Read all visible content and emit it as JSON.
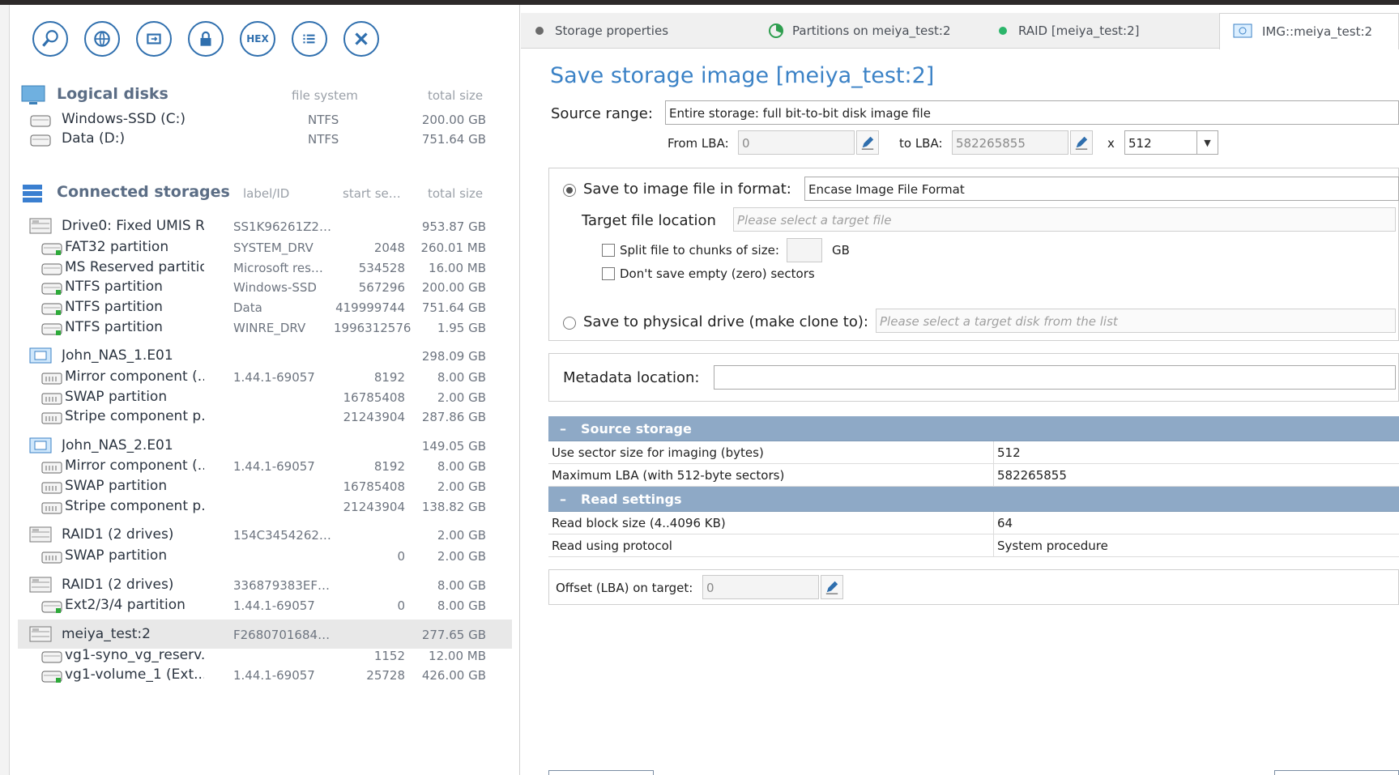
{
  "toolbar": {
    "buttons": [
      {
        "icon": "search-icon"
      },
      {
        "icon": "globe-icon"
      },
      {
        "icon": "sync-icon"
      },
      {
        "icon": "lock-icon"
      },
      {
        "icon": "hex-icon",
        "label": "HEX"
      },
      {
        "icon": "list-icon"
      },
      {
        "icon": "close-icon"
      }
    ]
  },
  "logical": {
    "title": "Logical disks",
    "col_fs": "file system",
    "col_size": "total size",
    "items": [
      {
        "name": "Windows-SSD (C:)",
        "fs": "NTFS",
        "size": "200.00 GB"
      },
      {
        "name": "Data (D:)",
        "fs": "NTFS",
        "size": "751.64 GB"
      }
    ]
  },
  "storages": {
    "title": "Connected storages",
    "col_label": "label/ID",
    "col_start": "start se…",
    "col_size": "total size",
    "items": [
      {
        "name": "Drive0: Fixed UMIS R...",
        "label": "SS1K96261Z2…",
        "start": "",
        "size": "953.87 GB"
      },
      {
        "name": "FAT32 partition",
        "label": "SYSTEM_DRV",
        "start": "2048",
        "size": "260.01 MB"
      },
      {
        "name": "MS Reserved partition",
        "label": "Microsoft res…",
        "start": "534528",
        "size": "16.00 MB"
      },
      {
        "name": "NTFS partition",
        "label": "Windows-SSD",
        "start": "567296",
        "size": "200.00 GB"
      },
      {
        "name": "NTFS partition",
        "label": "Data",
        "start": "419999744",
        "size": "751.64 GB"
      },
      {
        "name": "NTFS partition",
        "label": "WINRE_DRV",
        "start": "1996312576",
        "size": "1.95 GB"
      },
      {
        "name": "John_NAS_1.E01",
        "label": "",
        "start": "",
        "size": "298.09 GB"
      },
      {
        "name": "Mirror component (...",
        "label": "1.44.1-69057",
        "start": "8192",
        "size": "8.00 GB"
      },
      {
        "name": "SWAP partition",
        "label": "",
        "start": "16785408",
        "size": "2.00 GB"
      },
      {
        "name": "Stripe component p...",
        "label": "",
        "start": "21243904",
        "size": "287.86 GB"
      },
      {
        "name": "John_NAS_2.E01",
        "label": "",
        "start": "",
        "size": "149.05 GB"
      },
      {
        "name": "Mirror component (...",
        "label": "1.44.1-69057",
        "start": "8192",
        "size": "8.00 GB"
      },
      {
        "name": "SWAP partition",
        "label": "",
        "start": "16785408",
        "size": "2.00 GB"
      },
      {
        "name": "Stripe component p...",
        "label": "",
        "start": "21243904",
        "size": "138.82 GB"
      },
      {
        "name": "RAID1 (2 drives)",
        "label": "154C3454262…",
        "start": "",
        "size": "2.00 GB"
      },
      {
        "name": "SWAP partition",
        "label": "",
        "start": "0",
        "size": "2.00 GB"
      },
      {
        "name": "RAID1 (2 drives)",
        "label": "336879383EF…",
        "start": "",
        "size": "8.00 GB"
      },
      {
        "name": "Ext2/3/4 partition",
        "label": "1.44.1-69057",
        "start": "0",
        "size": "8.00 GB"
      },
      {
        "name": "meiya_test:2",
        "label": "F2680701684…",
        "start": "",
        "size": "277.65 GB"
      },
      {
        "name": "vg1-syno_vg_reserv...",
        "label": "",
        "start": "1152",
        "size": "12.00 MB"
      },
      {
        "name": "vg1-volume_1 (Ext...",
        "label": "1.44.1-69057",
        "start": "25728",
        "size": "426.00 GB"
      }
    ]
  },
  "tabs": [
    {
      "label": "Storage properties",
      "dot_color": "#6b6b6b"
    },
    {
      "label": "Partitions on meiya_test:2",
      "dot_color": "#2e9e4f"
    },
    {
      "label": "RAID [meiya_test:2]",
      "dot_color": "#2bb56a"
    },
    {
      "label": "IMG::meiya_test:2",
      "dot_color": "#3b82c6"
    }
  ],
  "form": {
    "title": "Save storage image [meiya_test:2]",
    "source_range_label": "Source range:",
    "source_range_value": "Entire storage: full bit-to-bit disk image file",
    "from_lba_label": "From LBA:",
    "from_lba_value": "0",
    "to_lba_label": "to LBA:",
    "to_lba_value": "582265855",
    "x_label": "x",
    "sector_value": "512",
    "save_image_label": "Save to image file in format:",
    "image_format": "Encase Image File Format",
    "target_location_label": "Target file location",
    "target_location_placeholder": "Please select a target file",
    "split_label": "Split file to chunks of size:",
    "split_value": "",
    "split_unit": "GB",
    "skip_empty_label": "Don't save empty (zero) sectors",
    "save_physical_label": "Save to physical drive (make clone to):",
    "physical_placeholder": "Please select a target disk from the list",
    "metadata_label": "Metadata location:",
    "metadata_value": "",
    "offset_label": "Offset (LBA) on target:",
    "offset_value": "0"
  },
  "props": {
    "source_storage": {
      "title": "Source storage",
      "rows": [
        {
          "key": "Use sector size for imaging (bytes)",
          "value": "512"
        },
        {
          "key": "Maximum LBA (with 512-byte sectors)",
          "value": "582265855"
        }
      ]
    },
    "read_settings": {
      "title": "Read settings",
      "rows": [
        {
          "key": "Read block size (4..4096 KB)",
          "value": "64"
        },
        {
          "key": "Read using protocol",
          "value": "System procedure"
        }
      ]
    }
  }
}
